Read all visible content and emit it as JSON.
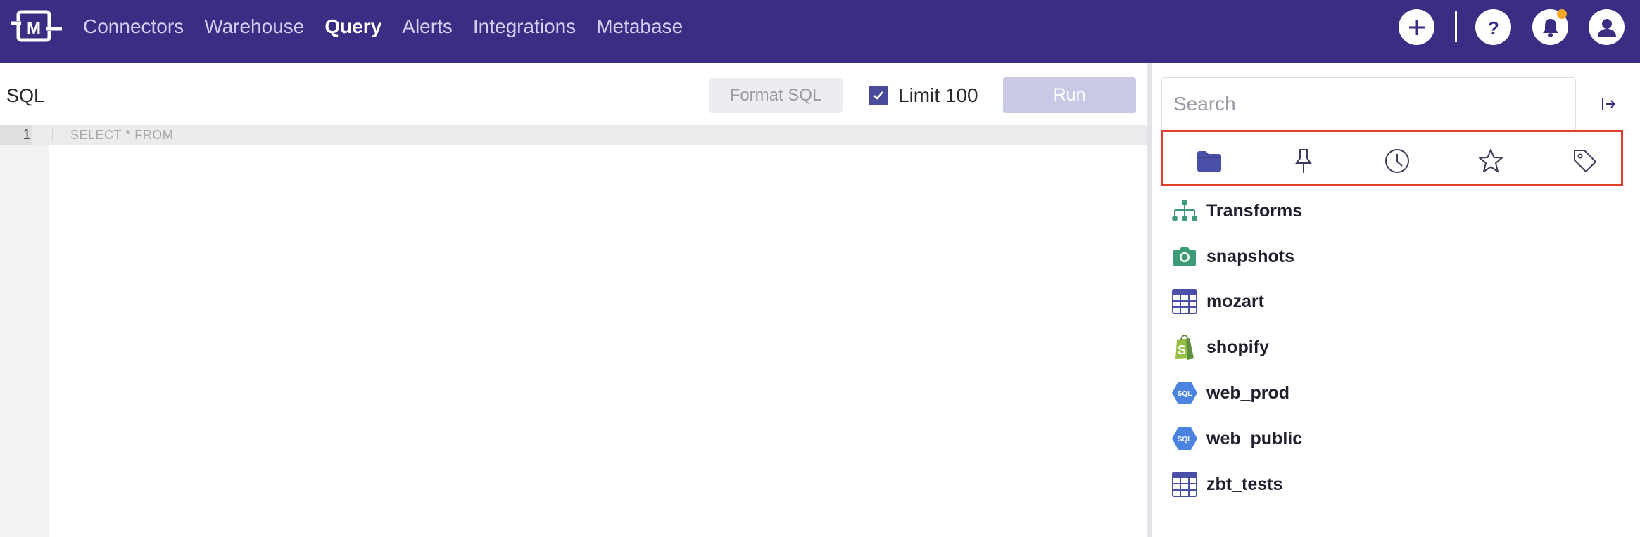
{
  "app": {
    "logo_letter": "M"
  },
  "nav": {
    "items": [
      {
        "label": "Connectors",
        "active": false
      },
      {
        "label": "Warehouse",
        "active": false
      },
      {
        "label": "Query",
        "active": true
      },
      {
        "label": "Alerts",
        "active": false
      },
      {
        "label": "Integrations",
        "active": false
      },
      {
        "label": "Metabase",
        "active": false
      }
    ]
  },
  "top_actions": {
    "add_icon": "plus-icon",
    "help_icon": "question-icon",
    "notifications_icon": "bell-icon",
    "account_icon": "user-icon"
  },
  "editor": {
    "title": "SQL",
    "format_label": "Format SQL",
    "limit_label": "Limit 100",
    "limit_checked": true,
    "run_label": "Run",
    "lines": [
      {
        "number": "1",
        "text": "SELECT * FROM"
      }
    ]
  },
  "browser": {
    "search_placeholder": "Search",
    "tabs": [
      {
        "icon": "folder-icon",
        "active": true
      },
      {
        "icon": "pin-icon",
        "active": false
      },
      {
        "icon": "clock-icon",
        "active": false
      },
      {
        "icon": "star-icon",
        "active": false
      },
      {
        "icon": "tag-icon",
        "active": false
      }
    ],
    "items": [
      {
        "label": "Transforms",
        "icon": "hierarchy-icon"
      },
      {
        "label": "snapshots",
        "icon": "camera-icon"
      },
      {
        "label": "mozart",
        "icon": "table-icon"
      },
      {
        "label": "shopify",
        "icon": "shopify-icon"
      },
      {
        "label": "web_prod",
        "icon": "sql-hexagon-icon"
      },
      {
        "label": "web_public",
        "icon": "sql-hexagon-icon"
      },
      {
        "label": "zbt_tests",
        "icon": "table-icon"
      }
    ]
  },
  "colors": {
    "nav_bg": "#3b2d83",
    "accent": "#4a4a9a",
    "transform_green": "#3e9b77",
    "sql_blue": "#4b83e0",
    "highlight_red": "#e0412e",
    "notification_orange": "#f5a524"
  }
}
